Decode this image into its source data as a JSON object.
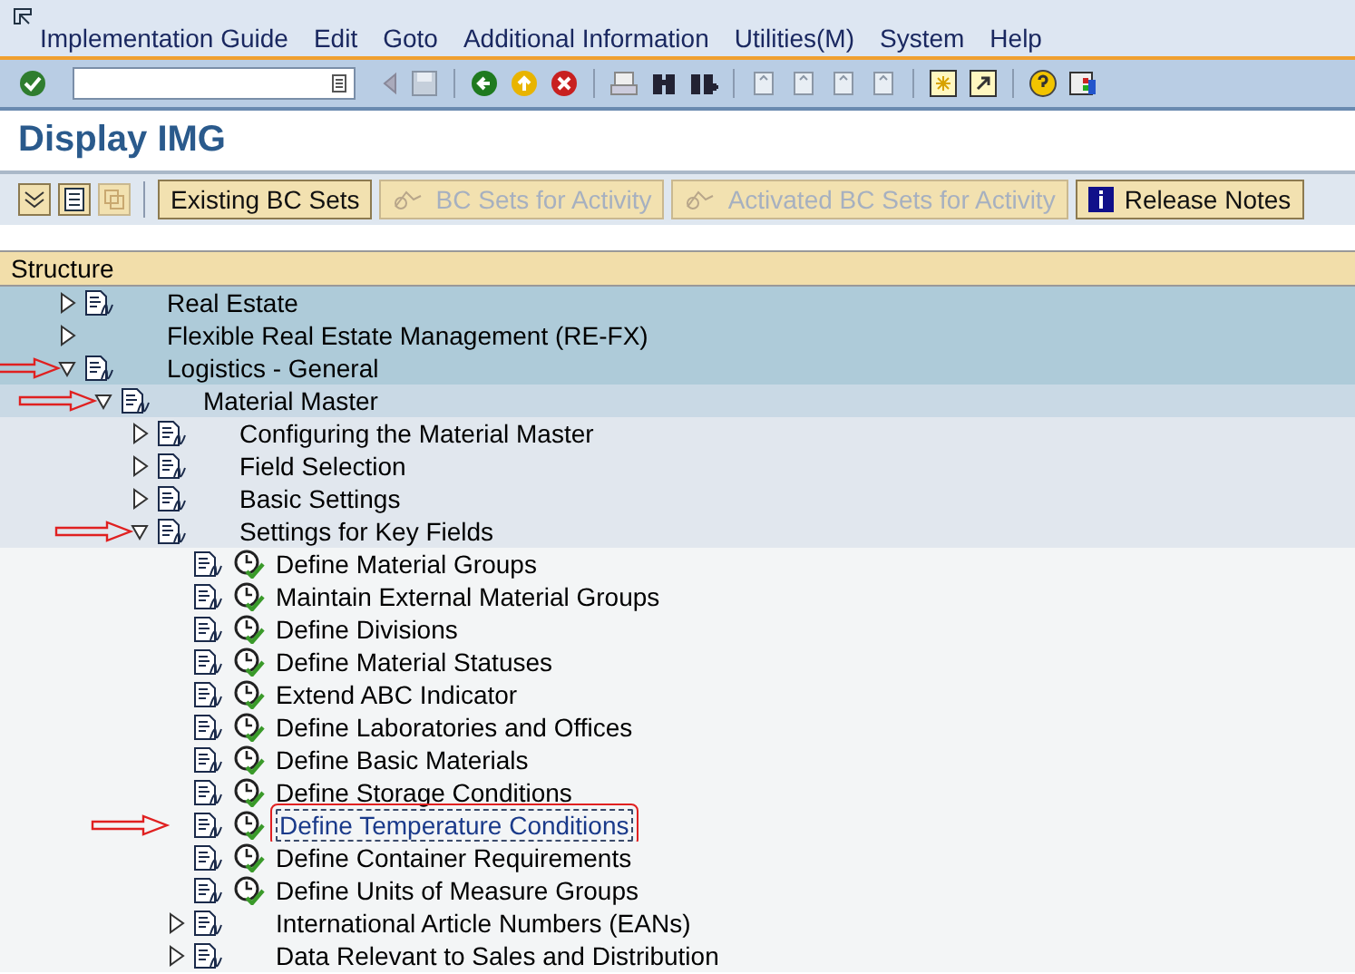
{
  "menu": [
    "Implementation Guide",
    "Edit",
    "Goto",
    "Additional Information",
    "Utilities(M)",
    "System",
    "Help"
  ],
  "title": "Display IMG",
  "buttons": [
    {
      "label": "Existing BC Sets",
      "disabled": false
    },
    {
      "label": "BC Sets for Activity",
      "disabled": true
    },
    {
      "label": "Activated BC Sets for Activity",
      "disabled": true
    },
    {
      "label": "Release Notes",
      "disabled": false
    }
  ],
  "structure_header": "Structure",
  "tree": [
    {
      "kind": "folder",
      "label": "Real Estate",
      "expanded": false,
      "documented": true,
      "arrow": false,
      "selected": false
    },
    {
      "kind": "folder",
      "label": "Flexible Real Estate Management (RE-FX)",
      "expanded": false,
      "documented": false,
      "arrow": false,
      "selected": false
    },
    {
      "kind": "folder",
      "label": "Logistics - General",
      "expanded": true,
      "documented": true,
      "arrow": true,
      "selected": false,
      "children": [
        {
          "kind": "folder",
          "label": "Material Master",
          "expanded": true,
          "documented": true,
          "arrow": true,
          "selected": false,
          "children": [
            {
              "kind": "folder",
              "label": "Configuring the Material Master",
              "expanded": false,
              "documented": true,
              "arrow": false,
              "selected": false
            },
            {
              "kind": "folder",
              "label": "Field Selection",
              "expanded": false,
              "documented": true,
              "arrow": false,
              "selected": false
            },
            {
              "kind": "folder",
              "label": "Basic Settings",
              "expanded": false,
              "documented": true,
              "arrow": false,
              "selected": false
            },
            {
              "kind": "folder",
              "label": "Settings for Key Fields",
              "expanded": true,
              "documented": true,
              "arrow": true,
              "selected": false,
              "children": [
                {
                  "kind": "activity",
                  "label": "Define Material Groups",
                  "documented": true,
                  "arrow": false,
                  "selected": false
                },
                {
                  "kind": "activity",
                  "label": "Maintain External Material Groups",
                  "documented": true,
                  "arrow": false,
                  "selected": false
                },
                {
                  "kind": "activity",
                  "label": "Define Divisions",
                  "documented": true,
                  "arrow": false,
                  "selected": false
                },
                {
                  "kind": "activity",
                  "label": "Define Material Statuses",
                  "documented": true,
                  "arrow": false,
                  "selected": false
                },
                {
                  "kind": "activity",
                  "label": "Extend ABC Indicator",
                  "documented": true,
                  "arrow": false,
                  "selected": false
                },
                {
                  "kind": "activity",
                  "label": "Define Laboratories and Offices",
                  "documented": true,
                  "arrow": false,
                  "selected": false
                },
                {
                  "kind": "activity",
                  "label": "Define Basic Materials",
                  "documented": true,
                  "arrow": false,
                  "selected": false
                },
                {
                  "kind": "activity",
                  "label": "Define Storage Conditions",
                  "documented": true,
                  "arrow": false,
                  "selected": false
                },
                {
                  "kind": "activity",
                  "label": "Define Temperature Conditions",
                  "documented": true,
                  "arrow": true,
                  "selected": true
                },
                {
                  "kind": "activity",
                  "label": "Define Container Requirements",
                  "documented": true,
                  "arrow": false,
                  "selected": false
                },
                {
                  "kind": "activity",
                  "label": "Define Units of Measure Groups",
                  "documented": true,
                  "arrow": false,
                  "selected": false
                },
                {
                  "kind": "folder",
                  "label": "International Article Numbers (EANs)",
                  "expanded": false,
                  "documented": true,
                  "arrow": false,
                  "selected": false
                },
                {
                  "kind": "folder",
                  "label": "Data Relevant to Sales and Distribution",
                  "expanded": false,
                  "documented": true,
                  "arrow": false,
                  "selected": false
                }
              ]
            }
          ]
        }
      ]
    }
  ]
}
